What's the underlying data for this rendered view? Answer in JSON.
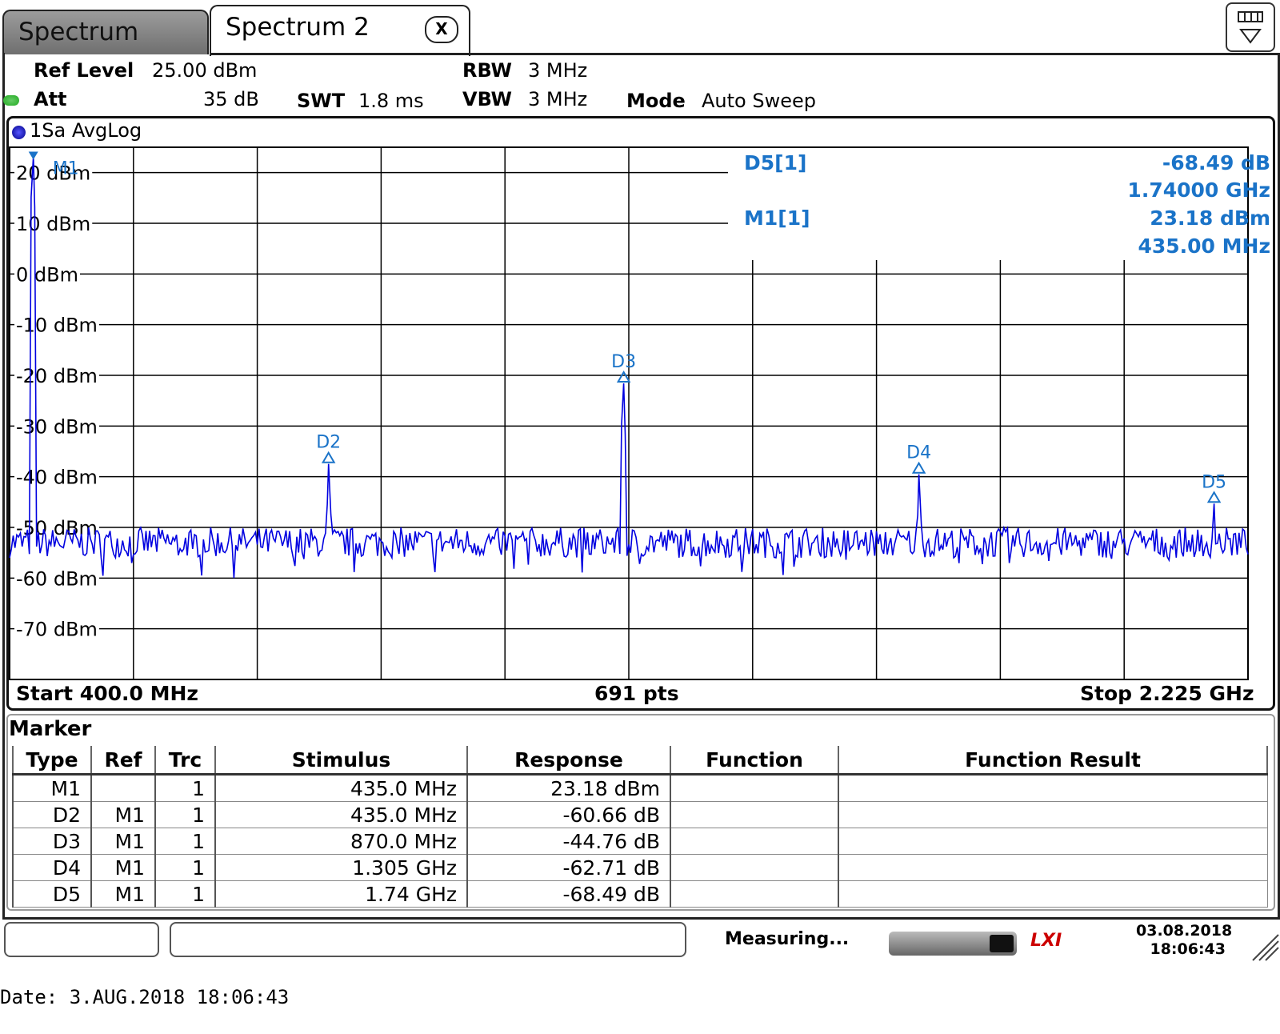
{
  "tabs": [
    {
      "label": "Spectrum"
    },
    {
      "label": "Spectrum 2"
    }
  ],
  "close_label": "X",
  "settings": {
    "label": "▤ ▽"
  },
  "header": {
    "ref_level_label": "Ref Level",
    "ref_level_value": "25.00 dBm",
    "att_label": "Att",
    "att_value": "35 dB",
    "swt_label": "SWT",
    "swt_value": "1.8 ms",
    "rbw_label": "RBW",
    "rbw_value": "3 MHz",
    "vbw_label": "VBW",
    "vbw_value": "3 MHz",
    "mode_label": "Mode",
    "mode_value": "Auto Sweep"
  },
  "trace_header": "1Sa AvgLog",
  "marker_readout": {
    "d5_name": "D5[1]",
    "d5_value": "-68.49 dB",
    "d5_freq": "1.74000 GHz",
    "m1_name": "M1[1]",
    "m1_value": "23.18 dBm",
    "m1_freq": "435.00 MHz"
  },
  "graph_footer": {
    "start": "Start 400.0 MHz",
    "points": "691 pts",
    "stop": "Stop 2.225 GHz"
  },
  "marker_table": {
    "title": "Marker",
    "headers": [
      "Type",
      "Ref",
      "Trc",
      "Stimulus",
      "Response",
      "Function",
      "Function Result"
    ],
    "rows": [
      [
        "M1",
        "",
        "1",
        "435.0 MHz",
        "23.18 dBm",
        "",
        ""
      ],
      [
        "D2",
        "M1",
        "1",
        "435.0 MHz",
        "-60.66 dB",
        "",
        ""
      ],
      [
        "D3",
        "M1",
        "1",
        "870.0 MHz",
        "-44.76 dB",
        "",
        ""
      ],
      [
        "D4",
        "M1",
        "1",
        "1.305 GHz",
        "-62.71 dB",
        "",
        ""
      ],
      [
        "D5",
        "M1",
        "1",
        "1.74 GHz",
        "-68.49 dB",
        "",
        ""
      ]
    ]
  },
  "status": {
    "measuring": "Measuring...",
    "lxi": "LXI",
    "date": "03.08.2018",
    "time": "18:06:43"
  },
  "footer_date": "Date: 3.AUG.2018  18:06:43",
  "colors": {
    "trace": "#0000e0",
    "marker": "#1a73c8",
    "grid": "#000000"
  },
  "chart_data": {
    "type": "line",
    "title": "",
    "xlabel": "",
    "ylabel": "",
    "xlim_mhz": [
      400.0,
      2225.0
    ],
    "ylim": [
      -80,
      25
    ],
    "y_ticks": [
      "20 dBm",
      "10 dBm",
      "0 dBm",
      "-10 dBm",
      "-20 dBm",
      "-30 dBm",
      "-40 dBm",
      "-50 dBm",
      "-60 dBm",
      "-70 dBm"
    ],
    "y_tick_values": [
      20,
      10,
      0,
      -10,
      -20,
      -30,
      -40,
      -50,
      -60,
      -70
    ],
    "x_divisions": 10,
    "grid": true,
    "noise_floor_dbm": -53,
    "peaks": [
      {
        "name": "M1",
        "freq_mhz": 435.0,
        "level": 23.18
      },
      {
        "name": "D2",
        "freq_mhz": 870.0,
        "level": -37.48
      },
      {
        "name": "D3",
        "freq_mhz": 1305.0,
        "level": -21.58
      },
      {
        "name": "D4",
        "freq_mhz": 1740.0,
        "level": -39.53
      },
      {
        "name": "D5",
        "freq_mhz": 2175.0,
        "level": -45.31
      }
    ]
  }
}
